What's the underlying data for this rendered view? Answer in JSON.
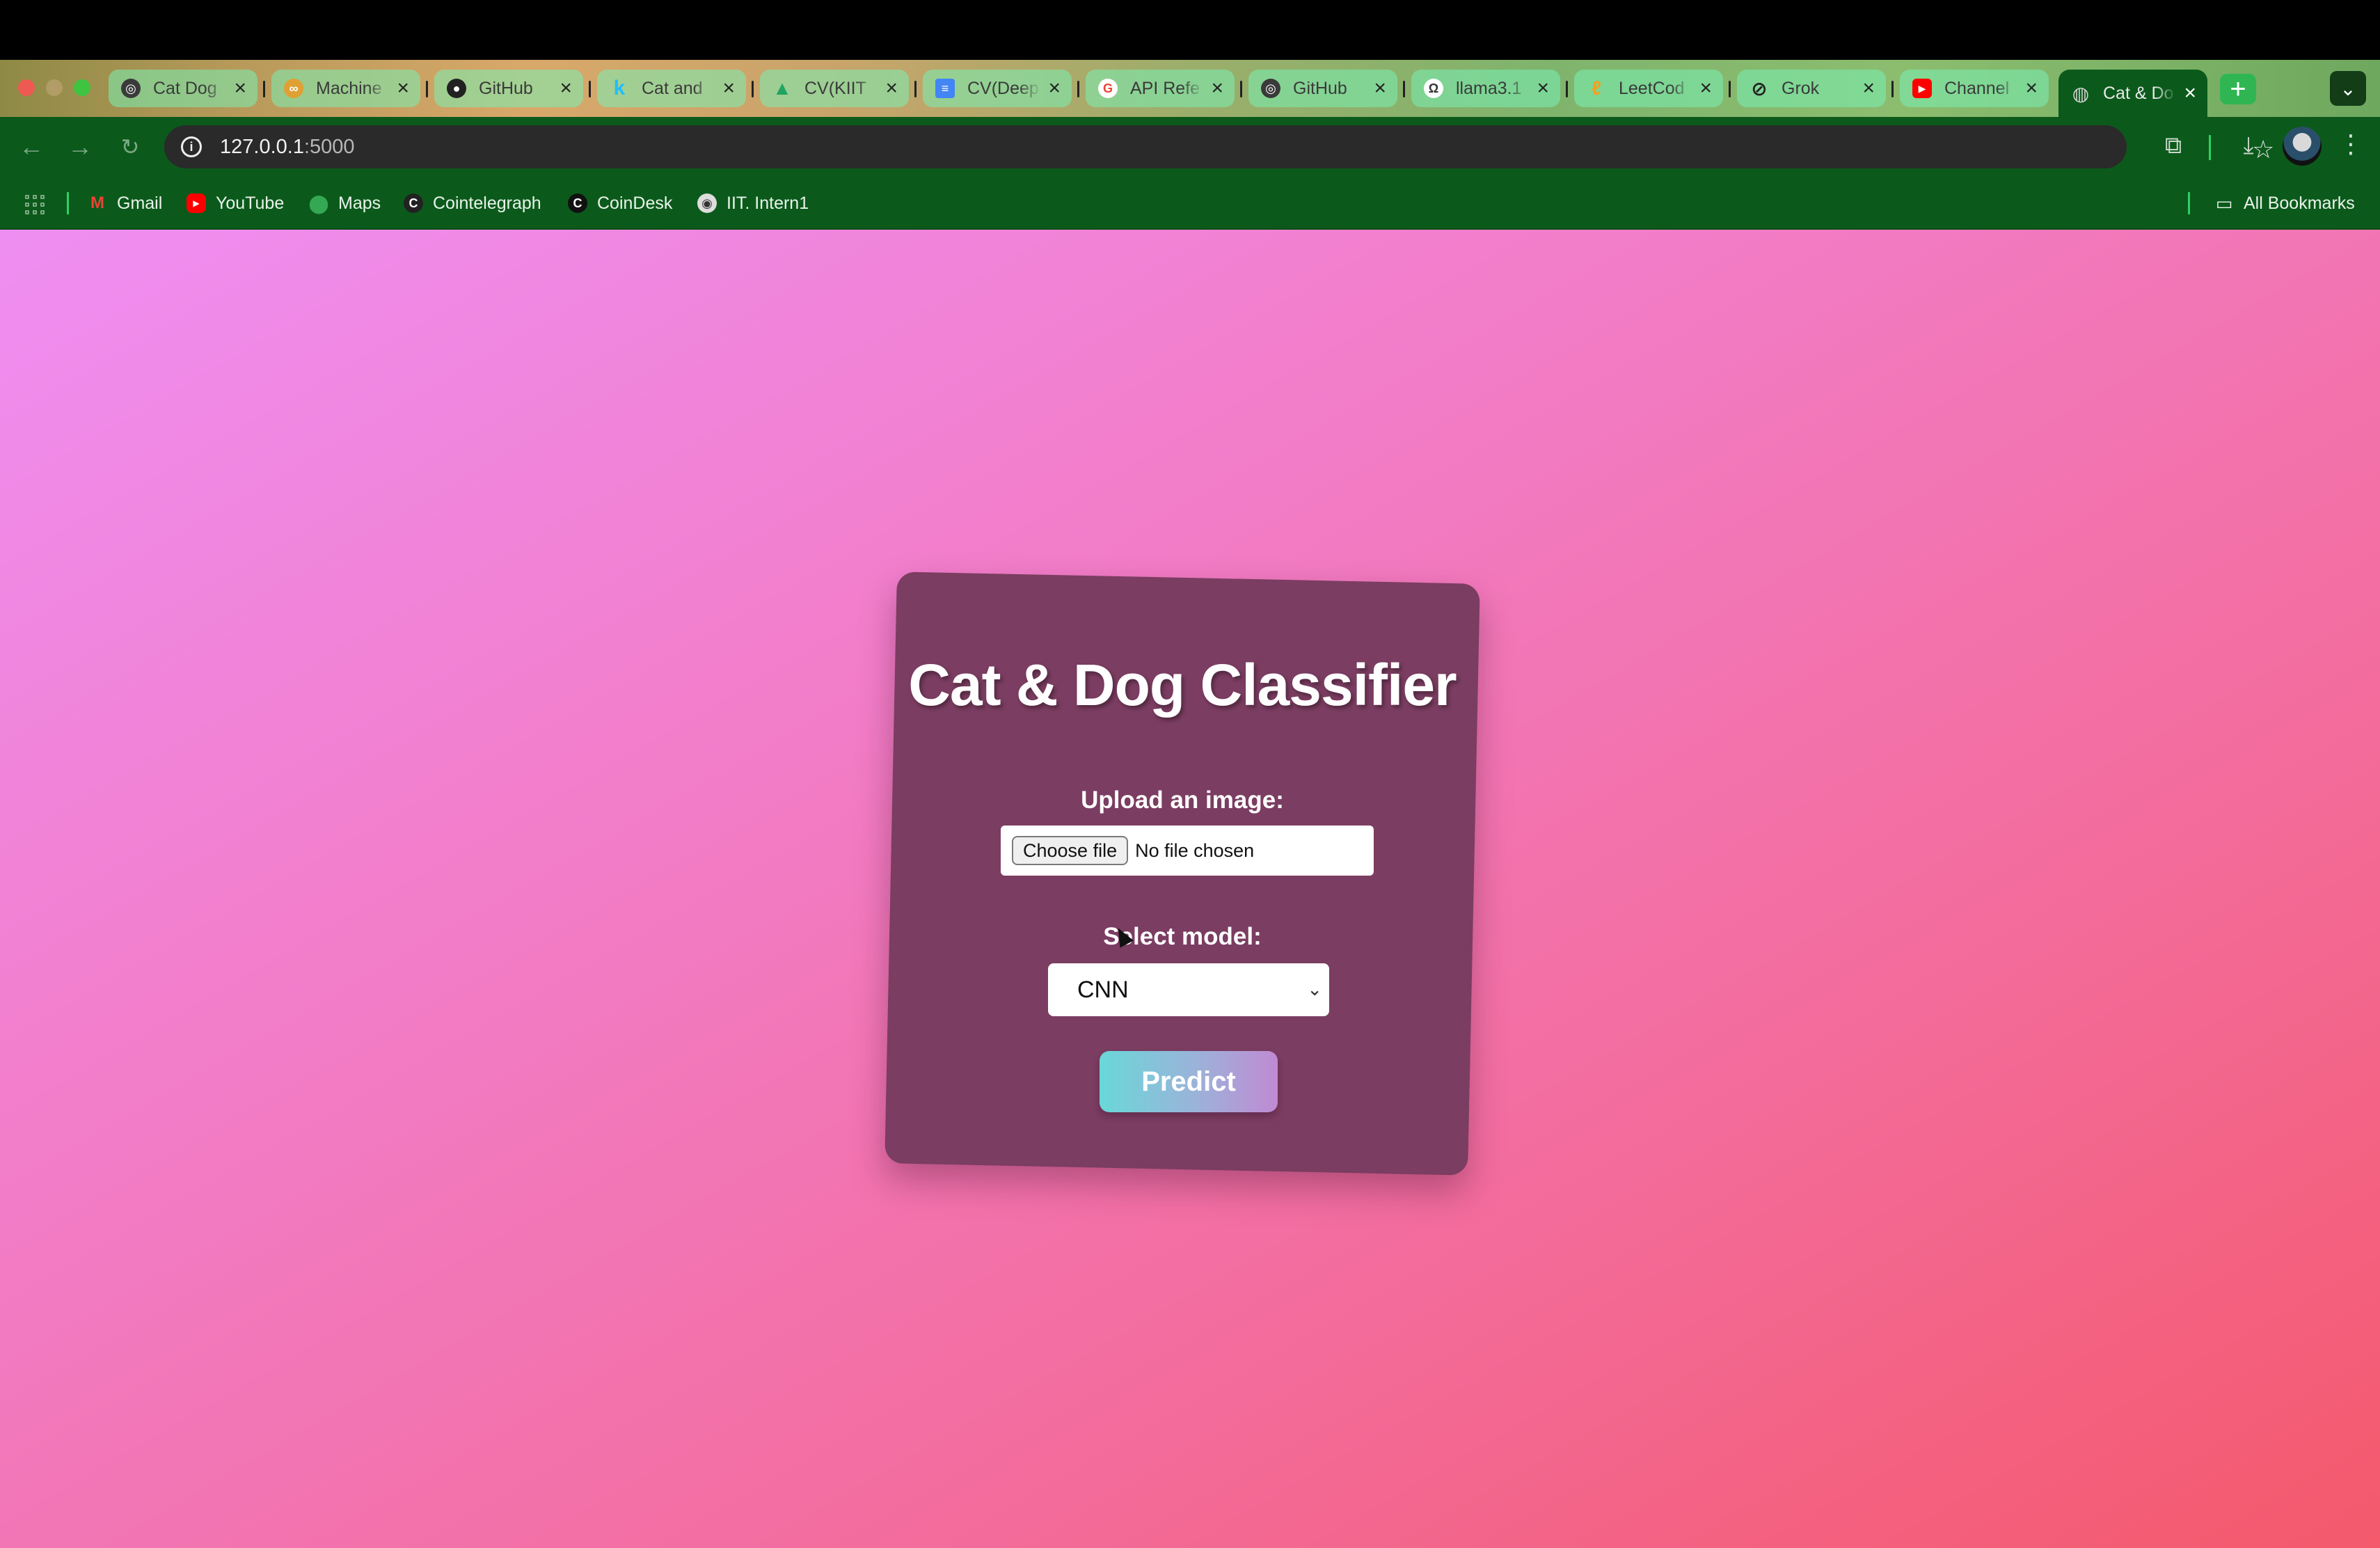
{
  "browser": {
    "tabs": [
      {
        "title": "Cat Dog",
        "icon": "openai-icon",
        "color": "#222222"
      },
      {
        "title": "Machine",
        "icon": "infinity-icon",
        "color": "#e0a033"
      },
      {
        "title": "GitHub",
        "icon": "github-icon",
        "color": "#222222"
      },
      {
        "title": "Cat and",
        "icon": "kaggle-icon",
        "color": "#20beff"
      },
      {
        "title": "CV(KIIT",
        "icon": "drive-icon",
        "color": "#1fa463"
      },
      {
        "title": "CV(Deep",
        "icon": "docs-icon",
        "color": "#4285f4"
      },
      {
        "title": "API Refe",
        "icon": "google-icon",
        "color": "#ea4335"
      },
      {
        "title": "GitHub",
        "icon": "openai-icon",
        "color": "#222222"
      },
      {
        "title": "llama3.1",
        "icon": "ollama-icon",
        "color": "#333333"
      },
      {
        "title": "LeetCod",
        "icon": "leetcode-icon",
        "color": "#f89f1b"
      },
      {
        "title": "Grok",
        "icon": "grok-icon",
        "color": "#222222"
      },
      {
        "title": "Channel",
        "icon": "youtube-icon",
        "color": "#ff0000"
      },
      {
        "title": "Cat & Do",
        "icon": "globe-icon",
        "color": "#cfcfcf",
        "active": true
      }
    ],
    "url_host": "127.0.0.1",
    "url_port": ":5000",
    "bookmarks": [
      {
        "label": "Gmail",
        "icon": "gmail-icon",
        "color": "#ea4335"
      },
      {
        "label": "YouTube",
        "icon": "youtube-icon",
        "color": "#ff0000"
      },
      {
        "label": "Maps",
        "icon": "maps-icon",
        "color": "#34a853"
      },
      {
        "label": "Cointelegraph",
        "icon": "cointelegraph-icon",
        "color": "#222222"
      },
      {
        "label": "CoinDesk",
        "icon": "coindesk-icon",
        "color": "#111111"
      },
      {
        "label": "IIT. Intern1",
        "icon": "iit-icon",
        "color": "#dddddd"
      }
    ],
    "all_bookmarks": "All Bookmarks"
  },
  "app": {
    "title": "Cat & Dog Classifier",
    "upload_label": "Upload an image:",
    "choose_file_label": "Choose file",
    "file_status": "No file chosen",
    "model_label": "Select model:",
    "model_selected": "CNN",
    "predict_label": "Predict"
  }
}
